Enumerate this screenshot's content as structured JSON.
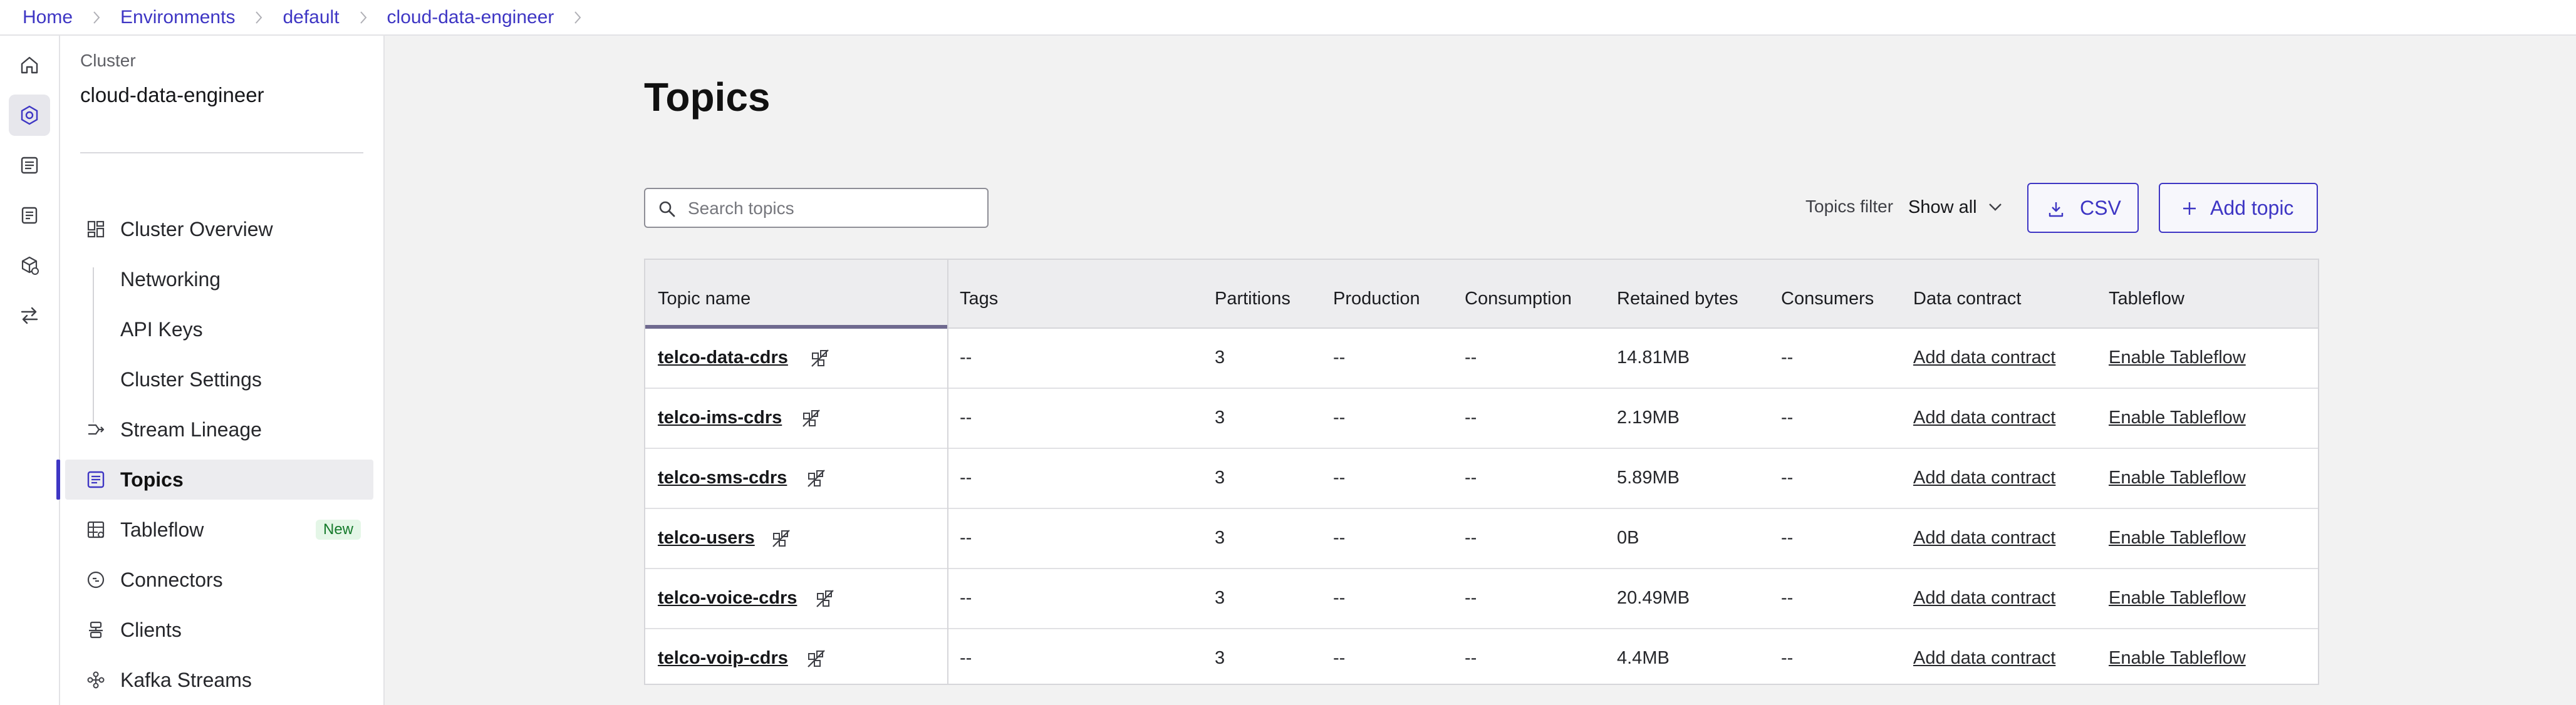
{
  "breadcrumb": [
    "Home",
    "Environments",
    "default",
    "cloud-data-engineer"
  ],
  "rail": {
    "icons": [
      "home-icon",
      "cluster-icon",
      "list-icon",
      "document-icon",
      "box-icon",
      "transfer-icon"
    ],
    "active_index": 1
  },
  "cluster": {
    "kicker": "Cluster",
    "name": "cloud-data-engineer"
  },
  "nav": {
    "cluster_overview": "Cluster Overview",
    "networking": "Networking",
    "api_keys": "API Keys",
    "cluster_settings": "Cluster Settings",
    "stream_lineage": "Stream Lineage",
    "topics": "Topics",
    "tableflow": "Tableflow",
    "tableflow_badge": "New",
    "connectors": "Connectors",
    "clients": "Clients",
    "kafka_streams": "Kafka Streams"
  },
  "page": {
    "title": "Topics"
  },
  "search": {
    "placeholder": "Search topics"
  },
  "filter": {
    "label": "Topics filter",
    "value": "Show all"
  },
  "buttons": {
    "csv": "CSV",
    "add_topic": "Add topic"
  },
  "colors": {
    "accent": "#3e36c4",
    "badge_bg": "#e4f6e7",
    "badge_text": "#157a2b"
  },
  "table": {
    "headers": [
      "Topic name",
      "Tags",
      "Partitions",
      "Production",
      "Consumption",
      "Retained bytes",
      "Consumers",
      "Data contract",
      "Tableflow"
    ],
    "rows": [
      {
        "name": "telco-data-cdrs",
        "tags": "--",
        "partitions": "3",
        "production": "--",
        "consumption": "--",
        "retained": "14.81MB",
        "consumers": "--",
        "contract": "Add data contract",
        "tableflow": "Enable Tableflow"
      },
      {
        "name": "telco-ims-cdrs",
        "tags": "--",
        "partitions": "3",
        "production": "--",
        "consumption": "--",
        "retained": "2.19MB",
        "consumers": "--",
        "contract": "Add data contract",
        "tableflow": "Enable Tableflow"
      },
      {
        "name": "telco-sms-cdrs",
        "tags": "--",
        "partitions": "3",
        "production": "--",
        "consumption": "--",
        "retained": "5.89MB",
        "consumers": "--",
        "contract": "Add data contract",
        "tableflow": "Enable Tableflow"
      },
      {
        "name": "telco-users",
        "tags": "--",
        "partitions": "3",
        "production": "--",
        "consumption": "--",
        "retained": "0B",
        "consumers": "--",
        "contract": "Add data contract",
        "tableflow": "Enable Tableflow"
      },
      {
        "name": "telco-voice-cdrs",
        "tags": "--",
        "partitions": "3",
        "production": "--",
        "consumption": "--",
        "retained": "20.49MB",
        "consumers": "--",
        "contract": "Add data contract",
        "tableflow": "Enable Tableflow"
      },
      {
        "name": "telco-voip-cdrs",
        "tags": "--",
        "partitions": "3",
        "production": "--",
        "consumption": "--",
        "retained": "4.4MB",
        "consumers": "--",
        "contract": "Add data contract",
        "tableflow": "Enable Tableflow"
      }
    ]
  }
}
